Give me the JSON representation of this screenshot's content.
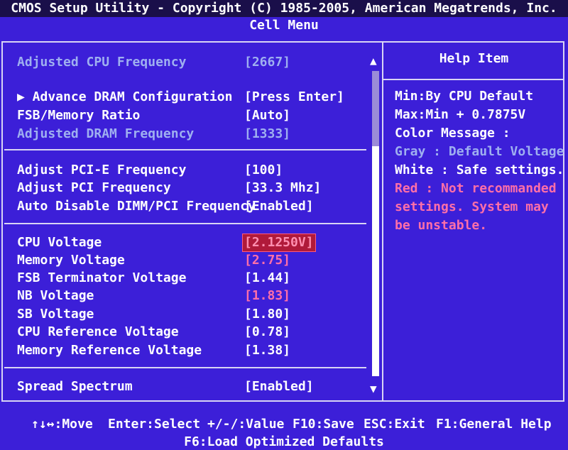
{
  "header": {
    "title": "CMOS Setup Utility - Copyright (C) 1985-2005, American Megatrends, Inc.",
    "menu": "Cell Menu"
  },
  "settings": [
    {
      "label": "Adjusted CPU Frequency",
      "value": "[2667]",
      "style": "gray"
    },
    {
      "label": "▶ Advance DRAM Configuration",
      "value": "[Press Enter]",
      "style": "normal"
    },
    {
      "label": "FSB/Memory Ratio",
      "value": "[Auto]",
      "style": "normal"
    },
    {
      "label": "Adjusted DRAM Frequency",
      "value": "[1333]",
      "style": "gray"
    },
    {
      "label": "Adjust PCI-E Frequency",
      "value": "[100]",
      "style": "normal"
    },
    {
      "label": "Adjust PCI Frequency",
      "value": "[33.3 Mhz]",
      "style": "normal"
    },
    {
      "label": "Auto Disable DIMM/PCI Frequency",
      "value": "[Enabled]",
      "style": "normal"
    },
    {
      "label": "CPU Voltage",
      "value": "[2.1250V]",
      "style": "selected"
    },
    {
      "label": "Memory Voltage",
      "value": "[2.75]",
      "style": "pink"
    },
    {
      "label": "FSB Terminator Voltage",
      "value": "[1.44]",
      "style": "normal"
    },
    {
      "label": "NB Voltage",
      "value": "[1.83]",
      "style": "pink"
    },
    {
      "label": "SB Voltage",
      "value": "[1.80]",
      "style": "normal"
    },
    {
      "label": "CPU Reference Voltage",
      "value": "[0.78]",
      "style": "normal"
    },
    {
      "label": "Memory Reference Voltage",
      "value": "[1.38]",
      "style": "normal"
    },
    {
      "label": "Spread Spectrum",
      "value": "[Enabled]",
      "style": "normal"
    }
  ],
  "help": {
    "title": "Help Item",
    "lines": [
      {
        "text": "Min:By CPU Default",
        "style": "normal"
      },
      {
        "text": "Max:Min + 0.7875V",
        "style": "normal"
      },
      {
        "text": "Color Message :",
        "style": "normal"
      },
      {
        "text": "Gray : Default Voltage",
        "style": "gray"
      },
      {
        "text": "White : Safe settings.",
        "style": "normal"
      },
      {
        "text": "Red : Not recommanded",
        "style": "pink"
      },
      {
        "text": "settings. System may",
        "style": "pink"
      },
      {
        "text": "be unstable.",
        "style": "pink"
      }
    ]
  },
  "scroll": {
    "up_glyph": "▲",
    "down_glyph": "▼"
  },
  "footer": {
    "move": "↑↓↔:Move",
    "enter": "Enter:Select",
    "value": "+/-/:Value",
    "save": "F10:Save",
    "exit": "ESC:Exit",
    "help": "F1:General Help",
    "defaults": "F6:Load Optimized Defaults"
  },
  "colors": {
    "background": "#3c1fd8",
    "gray_text": "#9fb0f0",
    "warning_text": "#ff6fa8",
    "selected_bg": "#b01a3a"
  }
}
